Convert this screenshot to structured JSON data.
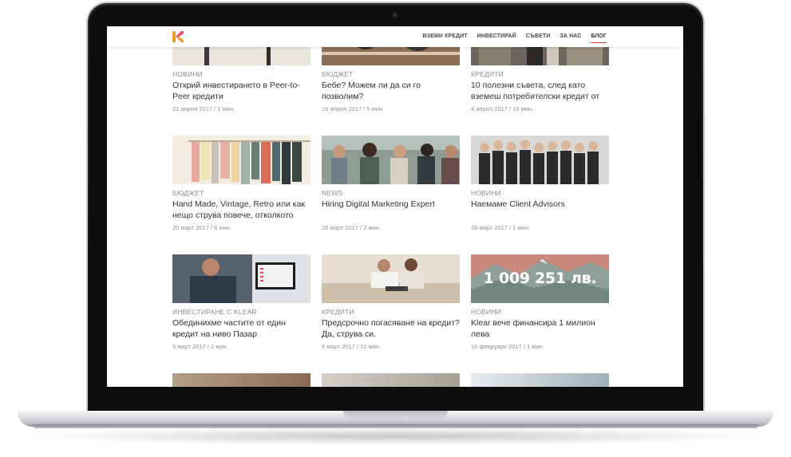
{
  "nav": {
    "items": [
      "ВЗЕМИ КРЕДИТ",
      "ИНВЕСТИРАЙ",
      "СЪВЕТИ",
      "ЗА НАС",
      "БЛОГ"
    ],
    "active": "БЛОГ"
  },
  "colors": {
    "brand_orange": "#f39a2d",
    "brand_pink": "#e84a6a",
    "accent_underline": "#e5393a"
  },
  "posts": [
    {
      "category": "НОВИНИ",
      "title": "Открий инвестирането в Peer-to-Peer кредити",
      "meta": "21 април 2017 / 1 мин."
    },
    {
      "category": "БЮДЖЕТ",
      "title": "Бебе? Можем ли да си го позволим?",
      "meta": "19 април 2017 / 5 мин."
    },
    {
      "category": "КРЕДИТИ",
      "title": "10 полезни съвета, след като вземеш потребителски кредит от",
      "meta": "4 април 2017 / 10 мин."
    },
    {
      "category": "БЮДЖЕТ",
      "title": "Hand Made, Vintage, Retro или как нещо струва повече, отколкото",
      "meta": "20 март 2017 / 6 мин."
    },
    {
      "category": "NEWS",
      "title": "Hiring Digital Marketing Expert",
      "meta": "20 март 2017 / 2 мин."
    },
    {
      "category": "НОВИНИ",
      "title": "Наемаме Client Advisors",
      "meta": "20 март 2017 / 1 мин."
    },
    {
      "category": "ИНВЕСТИРАНЕ С KLEAR",
      "title": "Обединихме частите от един кредит на ниво Пазар",
      "meta": "9 март 2017 / 2 мин."
    },
    {
      "category": "КРЕДИТИ",
      "title": "Предсрочно погасяване на кредит? Да, струва си.",
      "meta": "6 март 2017 / 10 мин."
    },
    {
      "category": "НОВИНИ",
      "title": "Klear вече финансира 1 милион лева",
      "meta": "10 февруари 2017 / 1 мин."
    }
  ],
  "banner_text": "1 009 251 лв."
}
